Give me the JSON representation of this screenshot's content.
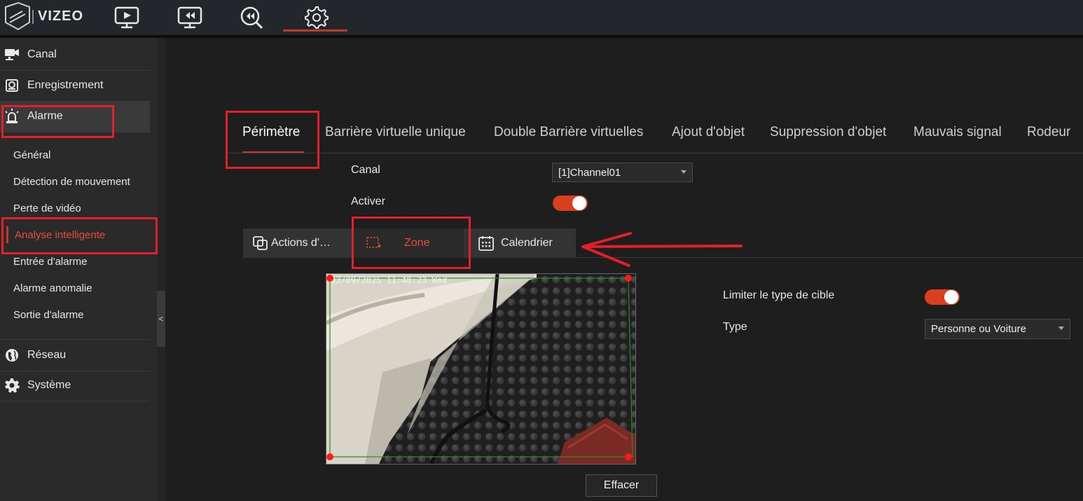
{
  "brand": {
    "logo_text": "VIZEO"
  },
  "topnav": {
    "items": [
      {
        "icon": "live-view-icon"
      },
      {
        "icon": "playback-icon"
      },
      {
        "icon": "search-playback-icon"
      },
      {
        "icon": "settings-gear-icon",
        "active": true
      }
    ]
  },
  "sidebar": {
    "collapse_glyph": "<",
    "main_items": [
      {
        "label": "Canal",
        "icon": "camera-icon"
      },
      {
        "label": "Enregistrement",
        "icon": "recorder-icon"
      },
      {
        "label": "Alarme",
        "icon": "alarm-light-icon",
        "active": true
      },
      {
        "label": "Réseau",
        "icon": "globe-icon"
      },
      {
        "label": "Système",
        "icon": "gear-icon"
      }
    ],
    "sub_items": [
      {
        "label": "Général"
      },
      {
        "label": "Détection de mouvement"
      },
      {
        "label": "Perte de vidéo"
      },
      {
        "label": "Analyse intelligente",
        "active": true
      },
      {
        "label": "Entrée d'alarme"
      },
      {
        "label": "Alarme anomalie"
      },
      {
        "label": "Sortie d'alarme"
      }
    ]
  },
  "tabs": [
    {
      "label": "Périmètre",
      "active": true
    },
    {
      "label": "Barrière virtuelle unique"
    },
    {
      "label": "Double Barrière virtuelles"
    },
    {
      "label": "Ajout d'objet"
    },
    {
      "label": "Suppression d'objet"
    },
    {
      "label": "Mauvais signal"
    },
    {
      "label": "Rodeur"
    }
  ],
  "form": {
    "channel_label": "Canal",
    "channel_value": "[1]Channel01",
    "enable_label": "Activer",
    "enable_on": true
  },
  "subtabs": [
    {
      "label": "Actions d'…",
      "icon": "copy-icon"
    },
    {
      "label": "Zone",
      "icon": "zone-select-icon",
      "active": true
    },
    {
      "label": "Calendrier",
      "icon": "calendar-icon"
    }
  ],
  "video": {
    "osd_text": "03/09/2025 11:48:23 Wed"
  },
  "settings": {
    "limit_label": "Limiter le type de cible",
    "limit_on": true,
    "type_label": "Type",
    "type_value": "Personne ou Voiture"
  },
  "actions": {
    "clear_label": "Effacer"
  },
  "colors": {
    "accent": "#c0392b",
    "toggle_on": "#d9401f",
    "highlight": "#e3202a",
    "zone_line": "#2e8b2e",
    "zone_corner": "#ff1a1a"
  }
}
